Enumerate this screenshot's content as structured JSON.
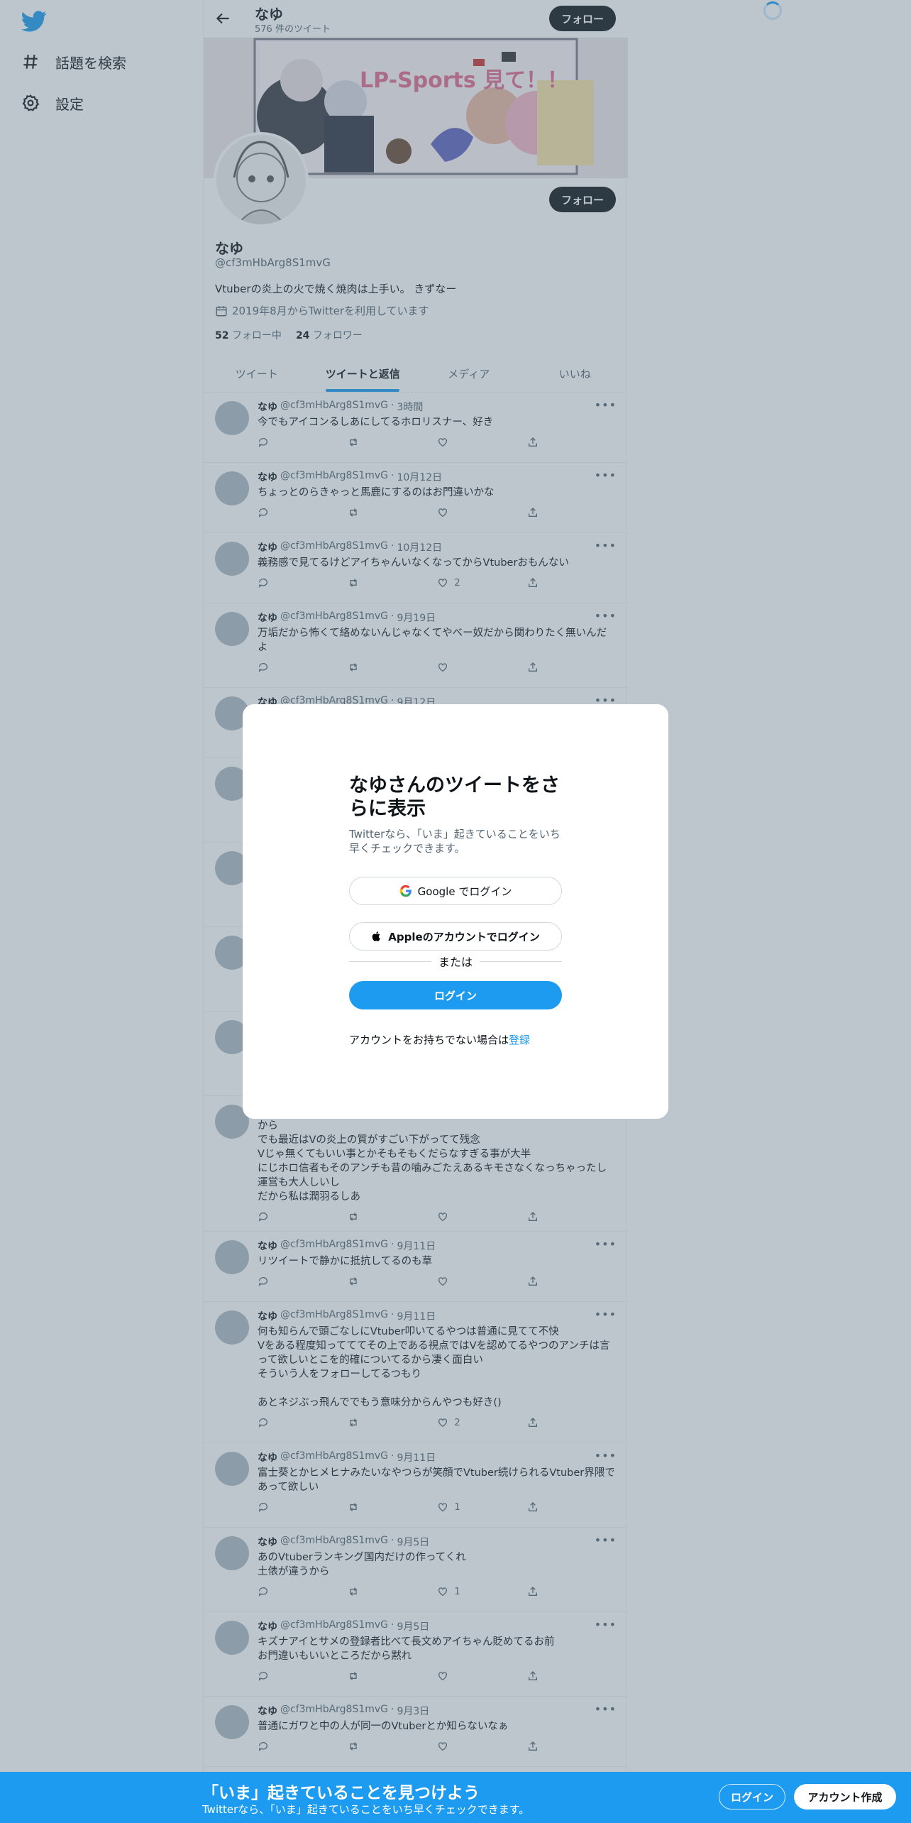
{
  "nav": {
    "explore": "話題を検索",
    "settings": "設定"
  },
  "header": {
    "name": "なゆ",
    "tweet_count": "576 件のツイート",
    "follow_label": "フォロー"
  },
  "profile": {
    "name": "なゆ",
    "handle": "@cf3mHbArg8S1mvG",
    "bio": "Vtuberの炎上の火で焼く焼肉は上手い。 きずなー",
    "joined": "2019年8月からTwitterを利用しています",
    "following_count": "52",
    "following_label": "フォロー中",
    "followers_count": "24",
    "followers_label": "フォロワー",
    "follow_label": "フォロー",
    "banner_text": "LP-Sports 見て！！"
  },
  "tabs": [
    "ツイート",
    "ツイートと返信",
    "メディア",
    "いいね"
  ],
  "tweets": [
    {
      "name": "なゆ",
      "handle": "@cf3mHbArg8S1mvG",
      "time": "3時間",
      "text": "今でもアイコンるしあにしてるホロリスナー、好き",
      "likes": ""
    },
    {
      "name": "なゆ",
      "handle": "@cf3mHbArg8S1mvG",
      "time": "10月12日",
      "text": "ちょっとのらきゃっと馬鹿にするのはお門違いかな",
      "likes": ""
    },
    {
      "name": "なゆ",
      "handle": "@cf3mHbArg8S1mvG",
      "time": "10月12日",
      "text": "義務感で見てるけどアイちゃんいなくなってからVtuberおもんない",
      "likes": "2"
    },
    {
      "name": "なゆ",
      "handle": "@cf3mHbArg8S1mvG",
      "time": "9月19日",
      "text": "万垢だから怖くて絡めないんじゃなくてやべー奴だから関わりたく無いんだよ",
      "likes": ""
    },
    {
      "name": "なゆ",
      "handle": "@cf3mHbArg8S1mvG",
      "time": "9月12日",
      "text": "",
      "likes": ""
    },
    {
      "name": "",
      "handle": "",
      "time": "",
      "text": "",
      "likes": ""
    },
    {
      "name": "",
      "handle": "",
      "time": "",
      "text": "",
      "likes": ""
    },
    {
      "name": "",
      "handle": "",
      "time": "",
      "text": "",
      "likes": ""
    },
    {
      "name": "",
      "handle": "",
      "time": "",
      "text": "",
      "likes": ""
    },
    {
      "name": "",
      "handle": "",
      "time": "",
      "text": "私がこんな垢でうだうだしてるのは19〜のVtuberの炎上がすごく面白かったから\nでも最近はVの炎上の質がすごい下がってて残念\nVじゃ無くてもいい事とかそもそもくだらなすぎる事が大半\nにじホロ信者もそのアンチも昔の噛みごたえあるキモさなくなっちゃったし運営も大人しいし\nだから私は潤羽るしあ",
      "likes": ""
    },
    {
      "name": "なゆ",
      "handle": "@cf3mHbArg8S1mvG",
      "time": "9月11日",
      "text": "リツイートで静かに抵抗してるのも草",
      "likes": ""
    },
    {
      "name": "なゆ",
      "handle": "@cf3mHbArg8S1mvG",
      "time": "9月11日",
      "text": "何も知らんで頭ごなしにVtuber叩いてるやつは普通に見てて不快\nVをある程度知ってててその上である視点ではVを認めてるやつのアンチは言って欲しいとこを的確についてるから凄く面白い\nそういう人をフォローしてるつもり\n\nあとネジぶっ飛んででもう意味分からんやつも好き()",
      "likes": "2"
    },
    {
      "name": "なゆ",
      "handle": "@cf3mHbArg8S1mvG",
      "time": "9月11日",
      "text": "富士葵とかヒメヒナみたいなやつらが笑顔でVtuber続けられるVtuber界隈であって欲しい",
      "likes": "1"
    },
    {
      "name": "なゆ",
      "handle": "@cf3mHbArg8S1mvG",
      "time": "9月5日",
      "text": "あのVtuberランキング国内だけの作ってくれ\n土俵が違うから",
      "likes": "1"
    },
    {
      "name": "なゆ",
      "handle": "@cf3mHbArg8S1mvG",
      "time": "9月5日",
      "text": "キズナアイとサメの登録者比べて長文めアイちゃん貶めてるお前\nお門違いもいいところだから黙れ",
      "likes": ""
    },
    {
      "name": "なゆ",
      "handle": "@cf3mHbArg8S1mvG",
      "time": "9月3日",
      "text": "普通にガワと中の人が同一のVtuberとか知らないなぁ",
      "likes": ""
    }
  ],
  "modal": {
    "title": "なゆさんのツイートをさらに表示",
    "subtitle": "Twitterなら、「いま」起きていることをいち早くチェックできます。",
    "google_label": "Google でログイン",
    "apple_label": "Appleのアカウントでログイン",
    "or_label": "または",
    "login_label": "ログイン",
    "signup_prompt": "アカウントをお持ちでない場合は",
    "signup_link": "登録"
  },
  "bottom_bar": {
    "title": "「いま」起きていることを見つけよう",
    "subtitle": "Twitterなら、「いま」起きていることをいち早くチェックできます。",
    "login_label": "ログイン",
    "signup_label": "アカウント作成"
  },
  "colors": {
    "accent": "#1d9bf0",
    "text": "#0f1419",
    "muted": "#536471"
  }
}
